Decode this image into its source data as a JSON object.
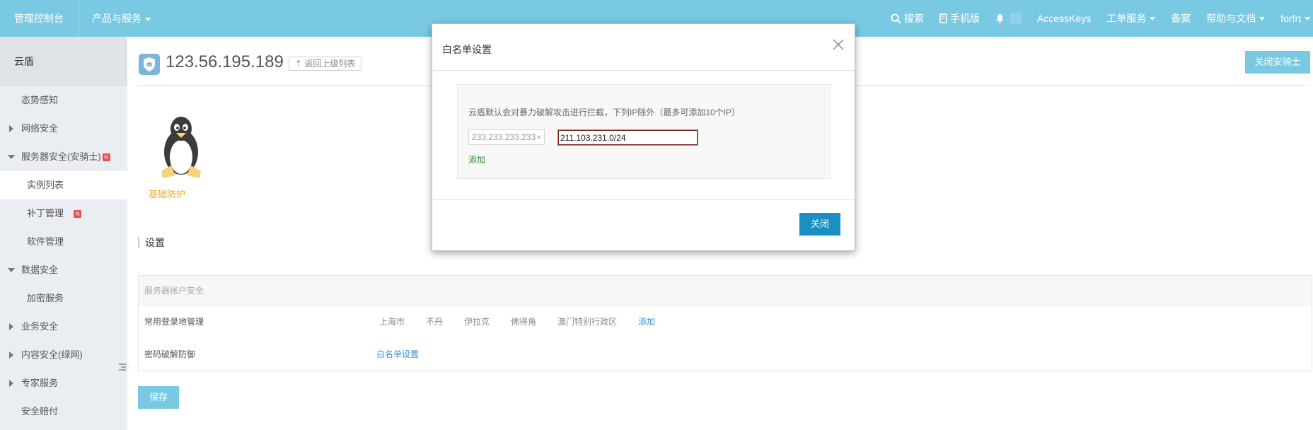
{
  "topbar": {
    "brand": "管理控制台",
    "products": "产品与服务",
    "search": "搜索",
    "mobile": "手机版",
    "accesskeys": "AccessKeys",
    "tickets": "工单服务",
    "beian": "备案",
    "help": "帮助与文档",
    "user": "forfrt"
  },
  "sidebar": {
    "title": "云盾",
    "items": [
      {
        "label": "态势感知"
      },
      {
        "label": "网络安全"
      },
      {
        "label": "服务器安全(安骑士)",
        "badge": "N"
      },
      {
        "label": "实例列表"
      },
      {
        "label": "补丁管理",
        "badge": "N"
      },
      {
        "label": "软件管理"
      },
      {
        "label": "数据安全"
      },
      {
        "label": "加密服务"
      },
      {
        "label": "业务安全"
      },
      {
        "label": "内容安全(绿网)"
      },
      {
        "label": "专家服务"
      },
      {
        "label": "安全赔付"
      }
    ]
  },
  "main": {
    "ip": "123.56.195.189",
    "back_label": "返回上级列表",
    "close_knight": "关闭安骑士",
    "protection_label": "基础防护",
    "settings_title": "设置",
    "panel": {
      "header": "服务器账户安全",
      "login_label": "常用登录地管理",
      "cities": [
        "上海市",
        "不丹",
        "伊拉克",
        "佛得角",
        "澳门特别行政区"
      ],
      "add_label": "添加",
      "brute_label": "密码破解防御",
      "whitelist_link": "白名单设置"
    },
    "save_label": "保存"
  },
  "modal": {
    "title": "白名单设置",
    "description": "云盾默认会对暴力破解攻击进行拦截，下列IP除外（最多可添加10个IP）",
    "existing_ip": "233.233.233.233",
    "tag_remove": "×",
    "input_value": "211.103.231.0/24",
    "add_label": "添加",
    "close_label": "关闭"
  }
}
